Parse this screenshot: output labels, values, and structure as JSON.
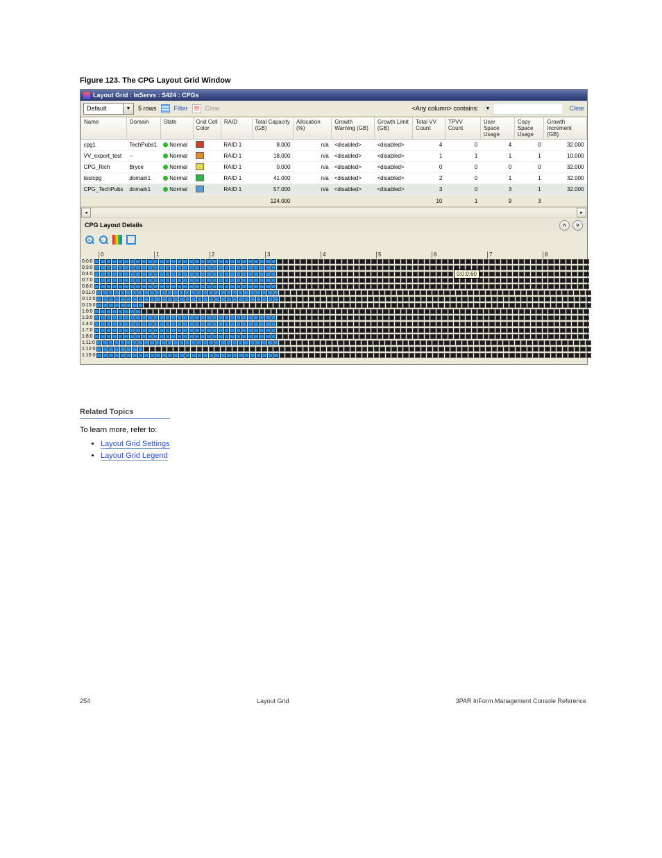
{
  "caption": "Figure 123. The CPG Layout Grid Window",
  "window": {
    "title": "Layout Grid : InServs : S424 : CPGs",
    "defaultSelect": "Default",
    "rowsText": "5 rows",
    "filterLabel": "Filter",
    "clearTop": "Clear",
    "searchLabel": "<Any column> contains:",
    "clearRight": "Clear"
  },
  "columns": [
    "Name",
    "Domain",
    "State",
    "Grid Cell Color",
    "RAID",
    "Total Capacity (GB)",
    "Allocation (%)",
    "Growth Warning (GB)",
    "Growth Limit (GB)",
    "Total VV Count",
    "TPVV Count",
    "User Space Usage",
    "Copy Space Usage",
    "Growth Increment (GB)"
  ],
  "rows": [
    {
      "name": "cpg1",
      "domain": "TechPubs1",
      "state": "Normal",
      "color": "#d63a2a",
      "raid": "RAID 1",
      "cap": "8.000",
      "alloc": "n/a",
      "gw": "<disabled>",
      "gl": "<disabled>",
      "tvv": "4",
      "tpvv": "0",
      "usu": "4",
      "csu": "0",
      "gi": "32.000"
    },
    {
      "name": "VV_export_test",
      "domain": "--",
      "state": "Normal",
      "color": "#e48a2a",
      "raid": "RAID 1",
      "cap": "18.000",
      "alloc": "n/a",
      "gw": "<disabled>",
      "gl": "<disabled>",
      "tvv": "1",
      "tpvv": "1",
      "usu": "1",
      "csu": "1",
      "gi": "10.000"
    },
    {
      "name": "CPG_Rich",
      "domain": "Bryce",
      "state": "Normal",
      "color": "#e6d94a",
      "raid": "RAID 1",
      "cap": "0.000",
      "alloc": "n/a",
      "gw": "<disabled>",
      "gl": "<disabled>",
      "tvv": "0",
      "tpvv": "0",
      "usu": "0",
      "csu": "0",
      "gi": "32.000"
    },
    {
      "name": "testcpg",
      "domain": "domain1",
      "state": "Normal",
      "color": "#2fb54a",
      "raid": "RAID 1",
      "cap": "41.000",
      "alloc": "n/a",
      "gw": "<disabled>",
      "gl": "<disabled>",
      "tvv": "2",
      "tpvv": "0",
      "usu": "1",
      "csu": "1",
      "gi": "32.000"
    },
    {
      "name": "CPG_TechPubs",
      "domain": "domain1",
      "state": "Normal",
      "color": "#5a9ad6",
      "raid": "RAID 1",
      "cap": "57.000",
      "alloc": "n/a",
      "gw": "<disabled>",
      "gl": "<disabled>",
      "tvv": "3",
      "tpvv": "0",
      "usu": "3",
      "csu": "1",
      "gi": "32.000"
    }
  ],
  "totals": {
    "cap": "124.000",
    "tvv": "10",
    "tpvv": "1",
    "usu": "9",
    "csu": "3"
  },
  "details": {
    "title": "CPG Layout Details",
    "tooltip": "0:0:0:60"
  },
  "grid": {
    "markers": [
      "0",
      "1",
      "2",
      "3",
      "4",
      "5",
      "6",
      "7",
      "8"
    ],
    "rows": [
      {
        "label": "0:0:0",
        "filled": 31,
        "total": 84
      },
      {
        "label": "0:3:0",
        "filled": 31,
        "total": 84
      },
      {
        "label": "0:4:0",
        "filled": 31,
        "total": 84
      },
      {
        "label": "0:7:0",
        "filled": 31,
        "total": 84
      },
      {
        "label": "0:8:0",
        "filled": 31,
        "total": 84
      },
      {
        "label": "0:11:0",
        "filled": 31,
        "total": 84
      },
      {
        "label": "0:12:0",
        "filled": 31,
        "total": 84
      },
      {
        "label": "0:15:0",
        "filled": 8,
        "total": 84
      },
      {
        "label": "1:0:0",
        "filled": 8,
        "total": 84
      },
      {
        "label": "1:3:0",
        "filled": 31,
        "total": 84
      },
      {
        "label": "1:4:0",
        "filled": 31,
        "total": 84
      },
      {
        "label": "1:7:0",
        "filled": 31,
        "total": 84
      },
      {
        "label": "1:8:0",
        "filled": 31,
        "total": 84
      },
      {
        "label": "1:11:0",
        "filled": 31,
        "total": 84
      },
      {
        "label": "1:12:0",
        "filled": 8,
        "total": 84
      },
      {
        "label": "1:15:0",
        "filled": 31,
        "total": 84
      }
    ]
  },
  "refs": {
    "title": "Related Topics",
    "bullet": "To learn more, refer to:",
    "links": [
      "Layout Grid Settings",
      "Layout Grid Legend"
    ]
  },
  "footer": {
    "left": "254",
    "center": "Layout Grid",
    "right": "3PAR InForm Management Console Reference"
  }
}
